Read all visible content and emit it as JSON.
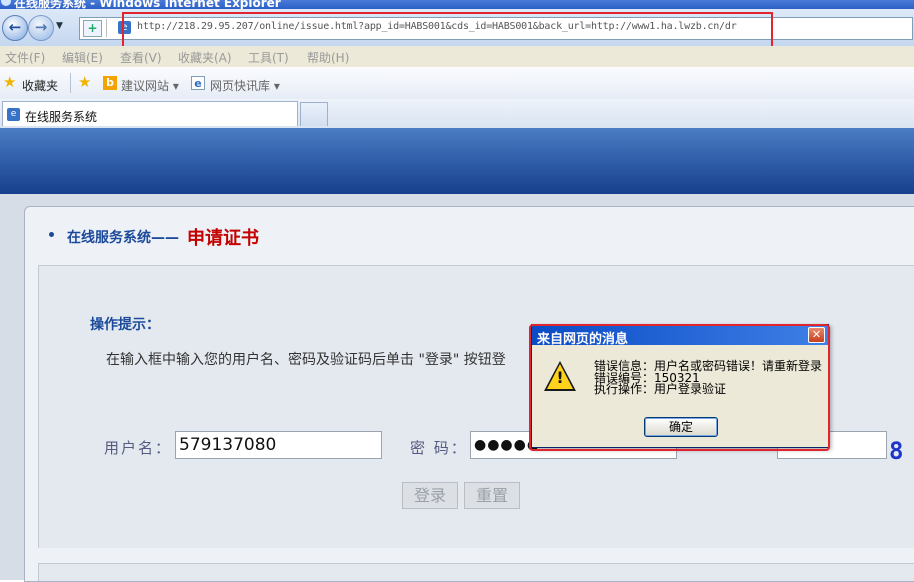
{
  "window": {
    "title": "在线服务系统 - Windows Internet Explorer"
  },
  "address_bar": {
    "url": "http://218.29.95.207/online/issue.html?app_id=HABS001&cds_id=HABS001&back_url=http://www1.ha.lwzb.cn/dr"
  },
  "menu": [
    "文件(F)",
    "编辑(E)",
    "查看(V)",
    "收藏夹(A)",
    "工具(T)",
    "帮助(H)"
  ],
  "favorites_bar": {
    "favorites": "收藏夹",
    "suggested_sites": "建议网站",
    "web_slice": "网页快讯库"
  },
  "tab": {
    "title": "在线服务系统"
  },
  "page": {
    "section_title": "在线服务系统——",
    "section_subtitle": "申请证书",
    "hint_title": "操作提示：",
    "hint_text": "在输入框中输入您的用户名、密码及验证码后单击 \"登录\" 按钮登",
    "username_label": "用户名：",
    "username_value": "579137080",
    "password_label": "密 码：",
    "password_value": "●●●●●",
    "captcha_value": "8",
    "login_button": "登录",
    "reset_button": "重置"
  },
  "dialog": {
    "title": "来自网页的消息",
    "error_info": "错误信息：用户名或密码错误！请重新登录",
    "error_code": "错误编号：150321",
    "action": "执行操作：用户登录验证",
    "ok_button": "确定"
  },
  "colors": {
    "highlight_red": "#e0252f",
    "title_blue": "#1b4a9b",
    "subtitle_red": "#c40000",
    "captcha_blue": "#1e35c9"
  }
}
